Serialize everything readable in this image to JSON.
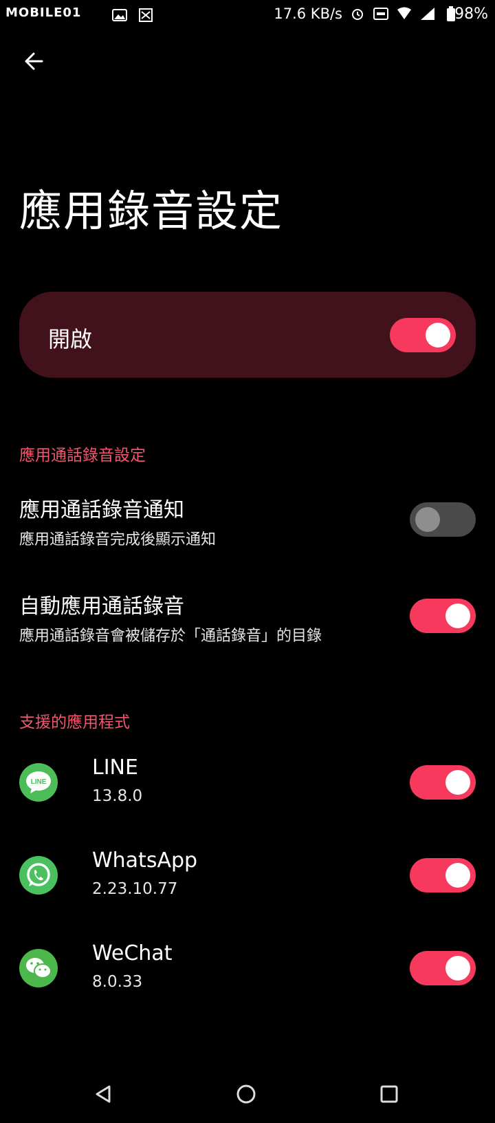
{
  "status_bar": {
    "watermark": "MOBILE01",
    "net_speed": "17.6 KB/s",
    "battery": "98%",
    "icons": [
      "gallery-icon",
      "app-icon",
      "alarm-icon",
      "auto-icon",
      "wifi-icon",
      "signal-icon",
      "battery-icon"
    ]
  },
  "page": {
    "title": "應用錄音設定"
  },
  "master": {
    "label": "開啟",
    "enabled": true
  },
  "call_section": {
    "header": "應用通話錄音設定",
    "items": [
      {
        "title": "應用通話錄音通知",
        "subtitle": "應用通話錄音完成後顯示通知",
        "enabled": false
      },
      {
        "title": "自動應用通話錄音",
        "subtitle": "應用通話錄音會被儲存於「通話錄音」的目錄",
        "enabled": true
      }
    ]
  },
  "apps_section": {
    "header": "支援的應用程式",
    "apps": [
      {
        "name": "LINE",
        "version": "13.8.0",
        "icon": "line-icon",
        "color": "#4cbd58",
        "enabled": true
      },
      {
        "name": "WhatsApp",
        "version": "2.23.10.77",
        "icon": "whatsapp-icon",
        "color": "#4bc05f",
        "enabled": true
      },
      {
        "name": "WeChat",
        "version": "8.0.33",
        "icon": "wechat-icon",
        "color": "#4cb74a",
        "enabled": true
      }
    ]
  },
  "colors": {
    "accent": "#f6395d",
    "card": "#42121c",
    "section_header": "#f2566f"
  }
}
